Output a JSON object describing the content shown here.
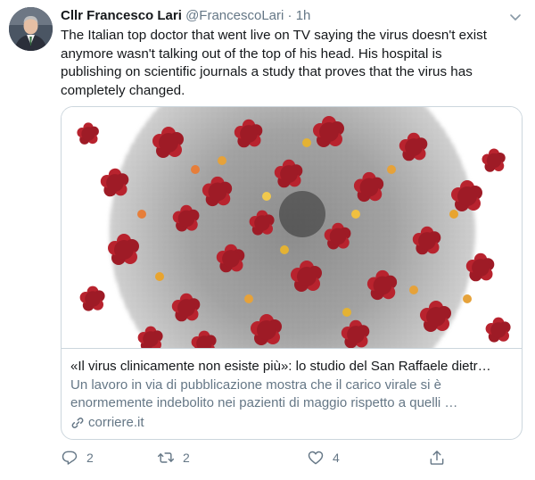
{
  "tweet": {
    "author_name": "Cllr Francesco Lari",
    "author_handle": "@FrancescoLari",
    "separator": "·",
    "time": "1h",
    "text": "The Italian top doctor that went live on TV saying the virus doesn't exist anymore wasn't talking out of the top of his head. His hospital is publishing on scientific journals a study that proves that the virus has completely changed."
  },
  "card": {
    "title": "«Il virus clinicamente non esiste più»: lo studio del San Raffaele dietr…",
    "description": "Un lavoro in via di pubblicazione mostra che il carico virale si è enormemente indebolito nei pazienti di maggio rispetto a quelli …",
    "domain": "corriere.it"
  },
  "actions": {
    "reply_count": "2",
    "retweet_count": "2",
    "like_count": "4"
  },
  "icons": {
    "reply": "reply-icon",
    "retweet": "retweet-icon",
    "like": "heart-icon",
    "share": "share-icon",
    "more": "chevron-down-icon",
    "link": "link-icon"
  },
  "colors": {
    "text": "#14171a",
    "secondary": "#657786",
    "border": "#ccd6dd",
    "virus_spike": "#b8232e"
  }
}
